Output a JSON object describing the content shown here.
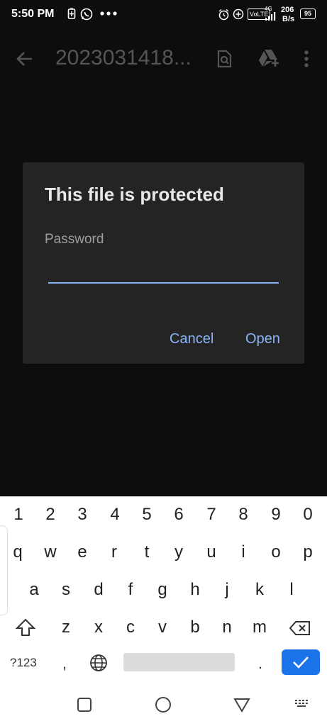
{
  "status": {
    "time": "5:50 PM",
    "speed_top": "206",
    "speed_bottom": "B/s",
    "battery": "95",
    "network": "VoLTE",
    "signal_tag": "4G"
  },
  "appbar": {
    "title": "2023031418..."
  },
  "dialog": {
    "title": "This file is protected",
    "password_label": "Password",
    "cancel_label": "Cancel",
    "open_label": "Open"
  },
  "keyboard": {
    "row1": [
      "1",
      "2",
      "3",
      "4",
      "5",
      "6",
      "7",
      "8",
      "9",
      "0"
    ],
    "row2": [
      "q",
      "w",
      "e",
      "r",
      "t",
      "y",
      "u",
      "i",
      "o",
      "p"
    ],
    "row3": [
      "a",
      "s",
      "d",
      "f",
      "g",
      "h",
      "j",
      "k",
      "l"
    ],
    "row4": [
      "z",
      "x",
      "c",
      "v",
      "b",
      "n",
      "m"
    ],
    "sym_label": "?123",
    "comma": ",",
    "period": "."
  },
  "colors": {
    "accent": "#8ab4f8",
    "enter_key": "#1a73e8",
    "dialog_bg": "#242424",
    "page_bg": "#0d0d0d"
  }
}
